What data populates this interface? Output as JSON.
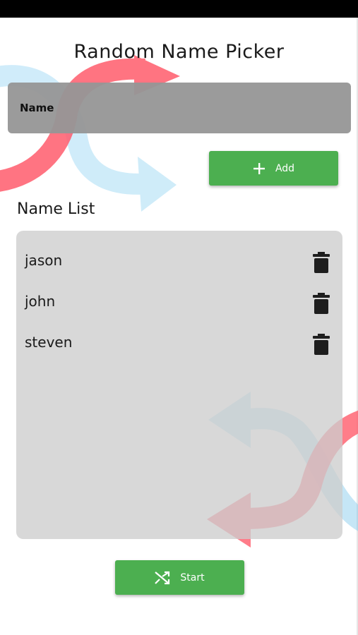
{
  "app": {
    "title": "Random Name Picker"
  },
  "name_input": {
    "placeholder": "Name",
    "value": ""
  },
  "add_button": {
    "label": "Add",
    "icon": "plus-icon"
  },
  "name_list": {
    "heading": "Name List",
    "items": [
      {
        "name": "jason",
        "icon": "trash-icon"
      },
      {
        "name": "john",
        "icon": "trash-icon"
      },
      {
        "name": "steven",
        "icon": "trash-icon"
      }
    ]
  },
  "start_button": {
    "label": "Start",
    "icon": "shuffle-icon"
  },
  "colors": {
    "accent_green": "#4caf50",
    "arrow_red": "#ff5c6c",
    "arrow_blue": "#a9ddf5",
    "field_gray": "#969696",
    "panel_gray": "#d9d9d9"
  }
}
